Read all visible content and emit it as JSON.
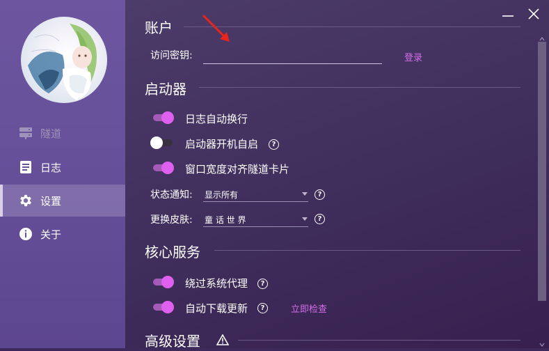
{
  "sidebar": {
    "items": [
      {
        "label": "隧道",
        "icon": "server-icon",
        "state": "disabled"
      },
      {
        "label": "日志",
        "icon": "log-icon",
        "state": "normal"
      },
      {
        "label": "设置",
        "icon": "gear-icon",
        "state": "active"
      },
      {
        "label": "关于",
        "icon": "info-icon",
        "state": "normal"
      }
    ]
  },
  "window": {
    "minimize_icon": "minimize-icon",
    "close_icon": "close-icon"
  },
  "account": {
    "title": "账户",
    "key_label": "访问密钥:",
    "key_value": "",
    "login_label": "登录"
  },
  "launcher": {
    "title": "启动器",
    "toggles": [
      {
        "label": "日志自动换行",
        "on": true,
        "help": false
      },
      {
        "label": "启动器开机自启",
        "on": false,
        "help": true
      },
      {
        "label": "窗口宽度对齐隧道卡片",
        "on": true,
        "help": false
      }
    ],
    "status_label": "状态通知:",
    "status_value": "显示所有",
    "skin_label": "更换皮肤:",
    "skin_value": "童 话 世 界"
  },
  "core": {
    "title": "核心服务",
    "toggles": [
      {
        "label": "绕过系统代理",
        "on": true,
        "help": true
      },
      {
        "label": "自动下载更新",
        "on": true,
        "help": true
      }
    ],
    "check_now_label": "立即检查"
  },
  "advanced": {
    "title": "高级设置",
    "icon": "warning-icon"
  },
  "colors": {
    "accent": "#d36ee8",
    "toggle_on": "#df5fef",
    "sidebar": "#66519a",
    "background": "#3f2d5b"
  }
}
